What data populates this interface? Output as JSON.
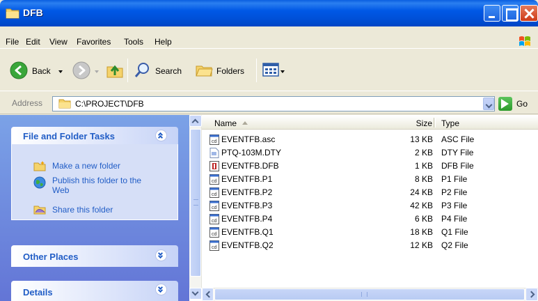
{
  "window": {
    "title": "DFB"
  },
  "menu": {
    "items": [
      {
        "label": "File"
      },
      {
        "label": "Edit"
      },
      {
        "label": "View"
      },
      {
        "label": "Favorites"
      },
      {
        "label": "Tools"
      },
      {
        "label": "Help"
      }
    ]
  },
  "toolbar": {
    "back_label": "Back",
    "search_label": "Search",
    "folders_label": "Folders"
  },
  "address": {
    "label": "Address",
    "path": "C:\\PROJECT\\DFB",
    "go_label": "Go"
  },
  "taskpane": {
    "file_folder_tasks": {
      "title": "File and Folder Tasks",
      "tasks": [
        {
          "label": "Make a new folder",
          "icon": "new-folder-icon"
        },
        {
          "label": "Publish this folder to the Web",
          "icon": "globe-icon"
        },
        {
          "label": "Share this folder",
          "icon": "share-folder-icon"
        }
      ]
    },
    "other_places": {
      "title": "Other Places"
    },
    "details": {
      "title": "Details"
    }
  },
  "filelist": {
    "columns": {
      "name": "Name",
      "size": "Size",
      "type": "Type"
    },
    "rows": [
      {
        "name": "EVENTFB.asc",
        "size": "13 KB",
        "type": "ASC File",
        "icon": "data-file-icon"
      },
      {
        "name": "PTQ-103M.DTY",
        "size": "2 KB",
        "type": "DTY File",
        "icon": "generic-file-icon"
      },
      {
        "name": "EVENTFB.DFB",
        "size": "1 KB",
        "type": "DFB File",
        "icon": "red-file-icon"
      },
      {
        "name": "EVENTFB.P1",
        "size": "8 KB",
        "type": "P1 File",
        "icon": "data-file-icon"
      },
      {
        "name": "EVENTFB.P2",
        "size": "24 KB",
        "type": "P2 File",
        "icon": "data-file-icon"
      },
      {
        "name": "EVENTFB.P3",
        "size": "42 KB",
        "type": "P3 File",
        "icon": "data-file-icon"
      },
      {
        "name": "EVENTFB.P4",
        "size": "6 KB",
        "type": "P4 File",
        "icon": "data-file-icon"
      },
      {
        "name": "EVENTFB.Q1",
        "size": "18 KB",
        "type": "Q1 File",
        "icon": "data-file-icon"
      },
      {
        "name": "EVENTFB.Q2",
        "size": "12 KB",
        "type": "Q2 File",
        "icon": "data-file-icon"
      }
    ]
  },
  "colors": {
    "titlebar": "#0054e3",
    "taskpane_bg": "#7ba2e7",
    "task_link": "#215dc6",
    "panel_body": "#d6dff7"
  }
}
